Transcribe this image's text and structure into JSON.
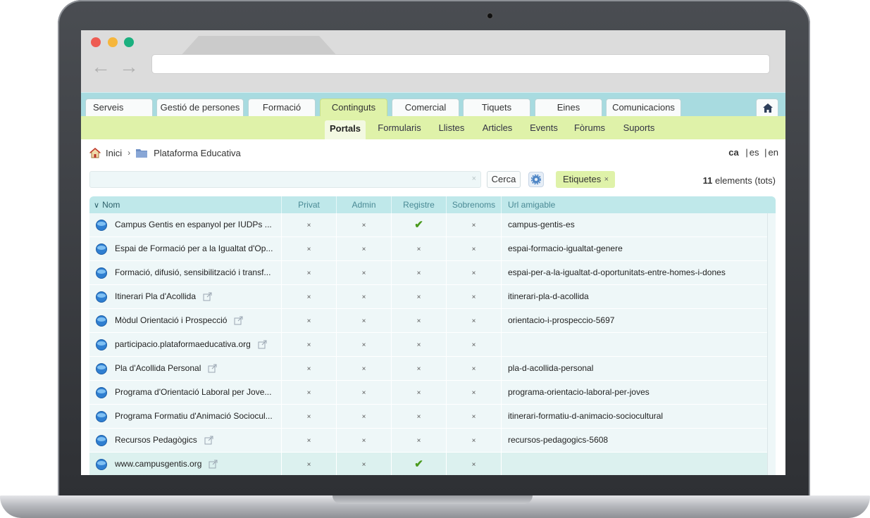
{
  "app": {
    "top_tabs": [
      {
        "label": "Serveis",
        "active": false
      },
      {
        "label": "Gestió de persones",
        "active": false
      },
      {
        "label": "Formació",
        "active": false
      },
      {
        "label": "Continguts",
        "active": true
      },
      {
        "label": "Comercial",
        "active": false
      },
      {
        "label": "Tiquets",
        "active": false
      },
      {
        "label": "Eines",
        "active": false
      },
      {
        "label": "Comunicacions",
        "active": false
      }
    ],
    "home_icon": "home-icon",
    "sub_menu": [
      {
        "label": "Portals",
        "active": true
      },
      {
        "label": "Formularis",
        "active": false
      },
      {
        "label": "Llistes",
        "active": false
      },
      {
        "label": "Articles",
        "active": false
      },
      {
        "label": "Events",
        "active": false
      },
      {
        "label": "Fòrums",
        "active": false
      },
      {
        "label": "Suports",
        "active": false
      }
    ]
  },
  "breadcrumb": {
    "home": "Inici",
    "separator": "›",
    "current": "Plataforma Educativa"
  },
  "languages": {
    "active": "ca",
    "others": [
      "es",
      "en"
    ],
    "separator": "|"
  },
  "search": {
    "value": "",
    "clear": "×",
    "button_label": "Cerca",
    "tag_label": "Etiquetes",
    "tag_remove": "×"
  },
  "count": {
    "number": "11",
    "suffix": "elements (tots)"
  },
  "table": {
    "sort_indicator": "∨",
    "columns": [
      "Nom",
      "Privat",
      "Admin",
      "Registre",
      "Sobrenoms",
      "Url amigable"
    ],
    "x_mark": "×",
    "check_mark": "✔",
    "rows": [
      {
        "name": "Campus Gentis en espanyol per IUDPs ...",
        "external": false,
        "privat": "×",
        "admin": "×",
        "registre": "✔",
        "sobrenoms": "×",
        "url": "campus-gentis-es"
      },
      {
        "name": "Espai de Formació per a la Igualtat d'Op...",
        "external": false,
        "privat": "×",
        "admin": "×",
        "registre": "×",
        "sobrenoms": "×",
        "url": "espai-formacio-igualtat-genere"
      },
      {
        "name": "Formació, difusió, sensibilització i transf...",
        "external": false,
        "privat": "×",
        "admin": "×",
        "registre": "×",
        "sobrenoms": "×",
        "url": "espai-per-a-la-igualtat-d-oportunitats-entre-homes-i-dones"
      },
      {
        "name": "Itinerari Pla d'Acollida",
        "external": true,
        "privat": "×",
        "admin": "×",
        "registre": "×",
        "sobrenoms": "×",
        "url": "itinerari-pla-d-acollida"
      },
      {
        "name": "Mòdul Orientació i Prospecció",
        "external": true,
        "privat": "×",
        "admin": "×",
        "registre": "×",
        "sobrenoms": "×",
        "url": "orientacio-i-prospeccio-5697"
      },
      {
        "name": "participacio.plataformaeducativa.org",
        "external": true,
        "privat": "×",
        "admin": "×",
        "registre": "×",
        "sobrenoms": "×",
        "url": ""
      },
      {
        "name": "Pla d'Acollida Personal",
        "external": true,
        "privat": "×",
        "admin": "×",
        "registre": "×",
        "sobrenoms": "×",
        "url": "pla-d-acollida-personal"
      },
      {
        "name": "Programa d'Orientació Laboral per Jove...",
        "external": false,
        "privat": "×",
        "admin": "×",
        "registre": "×",
        "sobrenoms": "×",
        "url": "programa-orientacio-laboral-per-joves"
      },
      {
        "name": "Programa Formatiu d'Animació Sociocul...",
        "external": false,
        "privat": "×",
        "admin": "×",
        "registre": "×",
        "sobrenoms": "×",
        "url": "itinerari-formatiu-d-animacio-sociocultural"
      },
      {
        "name": "Recursos Pedagògics",
        "external": true,
        "privat": "×",
        "admin": "×",
        "registre": "×",
        "sobrenoms": "×",
        "url": "recursos-pedagogics-5608"
      },
      {
        "name": "www.campusgentis.org",
        "external": true,
        "privat": "×",
        "admin": "×",
        "registre": "✔",
        "sobrenoms": "×",
        "url": ""
      }
    ]
  },
  "colors": {
    "teal_bar": "#a8dbe0",
    "green_bar": "#dff2a9",
    "row_bg": "#eef7f8",
    "check_green": "#4a9a1e"
  }
}
